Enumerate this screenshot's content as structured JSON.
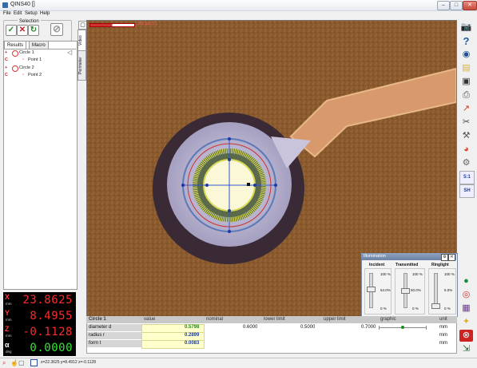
{
  "window": {
    "title": "QINS40 []",
    "min": "–",
    "max": "□",
    "close": "✕"
  },
  "menu": [
    "File",
    "Edit",
    "Setup",
    "Help"
  ],
  "selection": {
    "title": "Selection"
  },
  "tabs": {
    "results": "Results",
    "macro": "Macro"
  },
  "tree": [
    {
      "label": "Circle 1",
      "type": "circle"
    },
    {
      "label": "Point 1",
      "type": "point"
    },
    {
      "label": "Circle 2",
      "type": "circle"
    },
    {
      "label": "Point 2",
      "type": "point"
    }
  ],
  "vtabs": {
    "video": "Video",
    "perimeter": "Perimeter"
  },
  "scale": {
    "label": "300 µm 5.1"
  },
  "readouts": {
    "x": {
      "axis": "X",
      "unit": "mm",
      "value": "23.8625"
    },
    "y": {
      "axis": "Y",
      "unit": "mm",
      "value": "8.4955"
    },
    "z": {
      "axis": "Z",
      "unit": "mm",
      "value": "-0.1128"
    },
    "a": {
      "axis": "α",
      "unit": "deg",
      "value": "0.0000"
    }
  },
  "table": {
    "headers": [
      "Circle 1",
      "value",
      "nominal",
      "lower limit",
      "upper limit",
      "graphic",
      "unit"
    ],
    "rows": [
      {
        "name": "diameter d",
        "value": "0.5798",
        "nominal": "0.6000",
        "lower": "0.5000",
        "upper": "0.7000",
        "unit": "mm"
      },
      {
        "name": "radius r",
        "value": "0.2899",
        "nominal": "",
        "lower": "",
        "upper": "",
        "unit": "mm"
      },
      {
        "name": "form t",
        "value": "0.0083",
        "nominal": "",
        "lower": "",
        "upper": "",
        "unit": "mm"
      }
    ]
  },
  "illumination": {
    "title": "Illumination",
    "channels": [
      {
        "name": "Incident",
        "top": "100 %",
        "mid": "54.0%",
        "bottom": "0 %",
        "level": 0.54
      },
      {
        "name": "Transmitted",
        "top": "100 %",
        "mid": "50.0%",
        "bottom": "0 %",
        "level": 0.5
      },
      {
        "name": "Ringlight",
        "top": "100 %",
        "mid": "5.0%",
        "bottom": "0 %",
        "level": 0.05
      }
    ]
  },
  "status": {
    "coords": "x=22.3625 y=8.4912 z=-0.1128"
  },
  "right_toolbar": [
    "camera-icon",
    "help-icon",
    "eye-icon",
    "folder-icon",
    "save-icon",
    "print-icon",
    "measure-icon",
    "cross-icon",
    "tools-icon",
    "color-icon",
    "settings-icon",
    "scale-label",
    "sh-label",
    "green-circle-icon",
    "target-icon",
    "grid-icon",
    "bulb-icon",
    "stop-icon",
    "exit-icon"
  ],
  "right_labels": {
    "scale": "5:1",
    "sh": "SH"
  },
  "colors": {
    "accent": "#2f6fb0",
    "readout": "#ff2a2a",
    "alpha": "#33e633",
    "value_bg": "#ffffcc"
  }
}
